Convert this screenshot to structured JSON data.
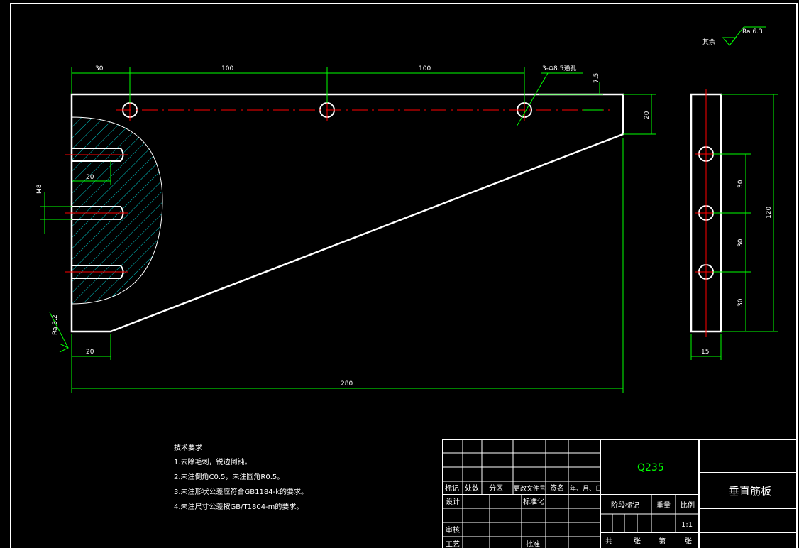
{
  "colors": {
    "background": "#000000",
    "outline": "#ffffff",
    "dimension": "#00ff00",
    "centerline": "#ff0000",
    "hatch": "#00c8c8"
  },
  "roughness": {
    "rest_label": "其余",
    "rest_value": "Ra 6.3",
    "left_value": "Ra 3.2"
  },
  "dimensions": {
    "d30": "30",
    "d100a": "100",
    "d100b": "100",
    "holes": "3-Φ8.5通孔",
    "d7_5": "7.5",
    "d20_right": "20",
    "d20_slot": "20",
    "m8": "M8",
    "d20_bottom": "20",
    "d280": "280",
    "side_30a": "30",
    "side_30b": "30",
    "side_30c": "30",
    "side_120": "120",
    "side_15": "15"
  },
  "tech_notes": {
    "title": "技术要求",
    "lines": [
      "1.去除毛刺，锐边倒钝。",
      "2.未注倒角C0.5，未注圆角R0.5。",
      "3.未注形状公差应符合GB1184-k的要求。",
      "4.未注尺寸公差按GB/T1804-m的要求。"
    ]
  },
  "title_block": {
    "material": "Q235",
    "part_name": "垂直筋板",
    "headers": [
      "标记",
      "处数",
      "分区",
      "更改文件号",
      "签名",
      "年、月、日"
    ],
    "design": "设计",
    "standardization": "标准化",
    "review": "审核",
    "process": "工艺",
    "approve": "批准",
    "stage_mark": "阶段标记",
    "weight": "重量",
    "scale": "比例",
    "scale_value": "1:1",
    "total": "共",
    "sheets": "张",
    "sheet_no": "第",
    "sheet_word": "张"
  }
}
